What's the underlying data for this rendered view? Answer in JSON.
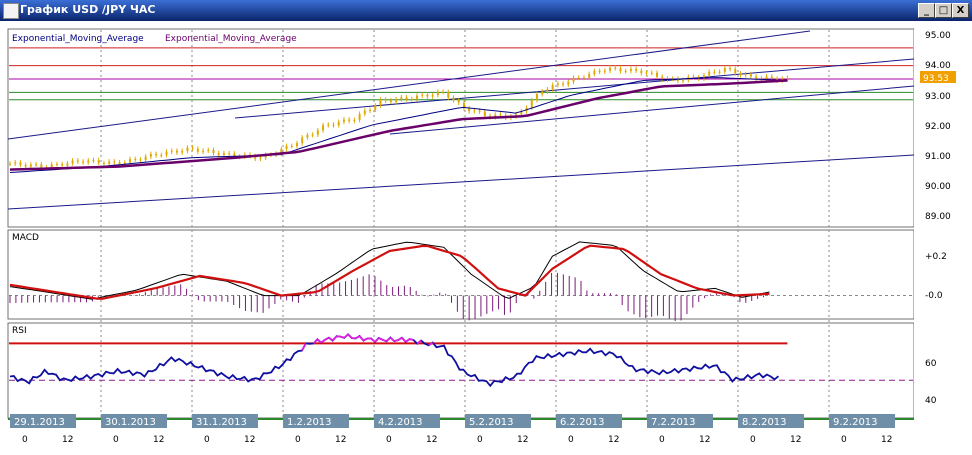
{
  "window": {
    "title": "График USD /JPY  ЧАС",
    "min_label": "_",
    "max_label": "□",
    "close_label": "X"
  },
  "price_panel": {
    "legend_1": "Exponential_Moving_Average",
    "legend_2": "Exponential_Moving_Average",
    "axis_ticks": [
      "95.00",
      "94.00",
      "93.00",
      "92.00",
      "91.00",
      "90.00",
      "89.00"
    ],
    "last_price": "93.53",
    "last_price_color": "#f0a000",
    "candle_color": "#e0a800"
  },
  "macd_panel": {
    "title": "MACD",
    "axis_ticks": [
      "+0.2",
      "-0.0"
    ]
  },
  "rsi_panel": {
    "title": "RSI",
    "axis_ticks": [
      "60",
      "40"
    ]
  },
  "time_axis": {
    "dates": [
      "29.1.2013",
      "30.1.2013",
      "31.1.2013",
      "1.2.2013",
      "4.2.2013",
      "5.2.2013",
      "6.2.2013",
      "7.2.2013",
      "8.2.2013",
      "9.2.2013"
    ],
    "hour_labels": [
      "0",
      "12"
    ]
  },
  "chart_data": {
    "type": "line",
    "title": "График USD /JPY  ЧАС",
    "series": [
      {
        "name": "Exponential_Moving_Average",
        "color": "#000080"
      },
      {
        "name": "Exponential_Moving_Average",
        "color": "#6a006a"
      }
    ],
    "price_ylim": [
      88.6,
      95.2
    ],
    "price_keyframes": [
      [
        0,
        90.7
      ],
      [
        0.04,
        90.6
      ],
      [
        0.08,
        90.8
      ],
      [
        0.12,
        90.7
      ],
      [
        0.16,
        91.0
      ],
      [
        0.2,
        91.2
      ],
      [
        0.24,
        91.0
      ],
      [
        0.28,
        90.9
      ],
      [
        0.31,
        91.3
      ],
      [
        0.35,
        92.0
      ],
      [
        0.38,
        92.2
      ],
      [
        0.41,
        92.8
      ],
      [
        0.44,
        92.9
      ],
      [
        0.48,
        93.1
      ],
      [
        0.5,
        92.6
      ],
      [
        0.53,
        92.3
      ],
      [
        0.56,
        92.3
      ],
      [
        0.59,
        93.2
      ],
      [
        0.63,
        93.6
      ],
      [
        0.66,
        93.9
      ],
      [
        0.7,
        93.8
      ],
      [
        0.73,
        93.5
      ],
      [
        0.76,
        93.6
      ],
      [
        0.79,
        93.9
      ],
      [
        0.82,
        93.6
      ],
      [
        0.86,
        93.53
      ]
    ],
    "ema_fast": [
      [
        0,
        90.4
      ],
      [
        0.1,
        90.6
      ],
      [
        0.2,
        90.9
      ],
      [
        0.3,
        91.0
      ],
      [
        0.4,
        92.0
      ],
      [
        0.5,
        92.6
      ],
      [
        0.56,
        92.4
      ],
      [
        0.62,
        93.0
      ],
      [
        0.7,
        93.5
      ],
      [
        0.78,
        93.6
      ],
      [
        0.86,
        93.5
      ]
    ],
    "ema_slow": [
      [
        0,
        90.5
      ],
      [
        0.12,
        90.6
      ],
      [
        0.25,
        90.9
      ],
      [
        0.32,
        91.1
      ],
      [
        0.42,
        91.8
      ],
      [
        0.5,
        92.2
      ],
      [
        0.57,
        92.3
      ],
      [
        0.65,
        92.9
      ],
      [
        0.72,
        93.3
      ],
      [
        0.8,
        93.4
      ],
      [
        0.86,
        93.5
      ]
    ],
    "horizontal_levels": [
      {
        "price": 94.6,
        "color": "#cc2222"
      },
      {
        "price": 94.0,
        "color": "#cc2222"
      },
      {
        "price": 93.55,
        "color": "#aa00aa"
      },
      {
        "price": 93.1,
        "color": "#2a8a2a"
      },
      {
        "price": 92.85,
        "color": "#2a8a2a"
      }
    ],
    "macd_ylim": [
      -0.12,
      0.35
    ],
    "macd_line": [
      [
        0,
        0.05
      ],
      [
        0.04,
        0.02
      ],
      [
        0.09,
        -0.02
      ],
      [
        0.14,
        0.03
      ],
      [
        0.19,
        0.12
      ],
      [
        0.24,
        0.08
      ],
      [
        0.28,
        0.0
      ],
      [
        0.32,
        0.0
      ],
      [
        0.36,
        0.12
      ],
      [
        0.4,
        0.26
      ],
      [
        0.44,
        0.3
      ],
      [
        0.48,
        0.27
      ],
      [
        0.51,
        0.12
      ],
      [
        0.55,
        -0.02
      ],
      [
        0.58,
        0.05
      ],
      [
        0.6,
        0.22
      ],
      [
        0.63,
        0.3
      ],
      [
        0.67,
        0.28
      ],
      [
        0.7,
        0.14
      ],
      [
        0.74,
        0.02
      ],
      [
        0.78,
        0.04
      ],
      [
        0.81,
        -0.01
      ],
      [
        0.84,
        0.02
      ]
    ],
    "macd_signal": [
      [
        0,
        0.06
      ],
      [
        0.05,
        0.02
      ],
      [
        0.1,
        -0.02
      ],
      [
        0.16,
        0.04
      ],
      [
        0.21,
        0.11
      ],
      [
        0.26,
        0.07
      ],
      [
        0.3,
        0.0
      ],
      [
        0.34,
        0.02
      ],
      [
        0.38,
        0.14
      ],
      [
        0.42,
        0.25
      ],
      [
        0.46,
        0.28
      ],
      [
        0.5,
        0.22
      ],
      [
        0.54,
        0.04
      ],
      [
        0.57,
        0.0
      ],
      [
        0.6,
        0.15
      ],
      [
        0.64,
        0.28
      ],
      [
        0.68,
        0.26
      ],
      [
        0.72,
        0.12
      ],
      [
        0.76,
        0.04
      ],
      [
        0.8,
        0.0
      ],
      [
        0.84,
        0.01
      ]
    ],
    "rsi_ylim": [
      30,
      80
    ],
    "rsi_line": [
      [
        0,
        52
      ],
      [
        0.02,
        49
      ],
      [
        0.04,
        55
      ],
      [
        0.06,
        50
      ],
      [
        0.09,
        52
      ],
      [
        0.12,
        55
      ],
      [
        0.15,
        53
      ],
      [
        0.18,
        62
      ],
      [
        0.21,
        57
      ],
      [
        0.24,
        52
      ],
      [
        0.27,
        50
      ],
      [
        0.3,
        58
      ],
      [
        0.33,
        70
      ],
      [
        0.37,
        74
      ],
      [
        0.4,
        72
      ],
      [
        0.44,
        72
      ],
      [
        0.48,
        68
      ],
      [
        0.5,
        55
      ],
      [
        0.53,
        48
      ],
      [
        0.56,
        52
      ],
      [
        0.58,
        62
      ],
      [
        0.61,
        64
      ],
      [
        0.64,
        66
      ],
      [
        0.67,
        64
      ],
      [
        0.69,
        56
      ],
      [
        0.72,
        54
      ],
      [
        0.75,
        56
      ],
      [
        0.78,
        58
      ],
      [
        0.8,
        50
      ],
      [
        0.83,
        53
      ],
      [
        0.85,
        51
      ]
    ],
    "rsi_levels": [
      70,
      50
    ]
  }
}
